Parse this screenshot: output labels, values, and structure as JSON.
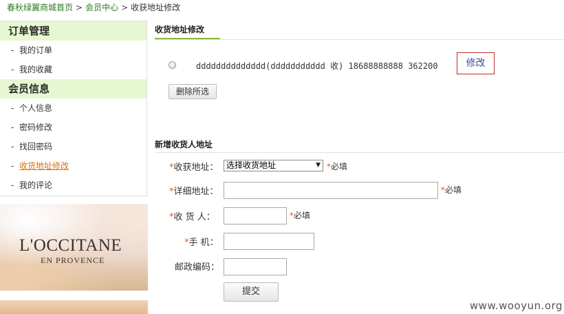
{
  "breadcrumb": {
    "home": "春秋绿翼商城首页",
    "member_center": "会员中心",
    "current": "收获地址修改",
    "separator": ">"
  },
  "sidebar": {
    "order_section": "订单管理",
    "order_items": [
      {
        "label": "我的订单"
      },
      {
        "label": "我的收藏"
      }
    ],
    "member_section": "会员信息",
    "member_items": [
      {
        "label": "个人信息"
      },
      {
        "label": "密码修改"
      },
      {
        "label": "找回密码"
      },
      {
        "label": "收货地址修改"
      },
      {
        "label": "我的评论"
      }
    ],
    "bullet": "-"
  },
  "banner": {
    "brand": "L'OCCITANE",
    "sub": "EN PROVENCE"
  },
  "address_list": {
    "title": "收货地址修改",
    "entry": "dddddddddddddd(ddddddddddd 收) 18688888888 362200",
    "edit_button": "修改",
    "delete_button": "删除所选"
  },
  "new_address": {
    "title": "新增收货人地址",
    "star": "*",
    "required_text": "必填",
    "region_label": "收获地址：",
    "region_select_value": "选择收货地址",
    "detail_label": "详细地址：",
    "receiver_label": "收 货 人：",
    "phone_label": "手  机：",
    "zip_label": "邮政编码：",
    "submit_button": "提交"
  },
  "watermark": "www.wooyun.org",
  "colors": {
    "accent_green": "#7fbf3e",
    "sidebar_header_bg": "#e6f7d2",
    "link_green": "#2c7a1f",
    "active_orange": "#d5740f",
    "edit_border_red": "#c42a2a",
    "required_star": "#e05a1a"
  }
}
